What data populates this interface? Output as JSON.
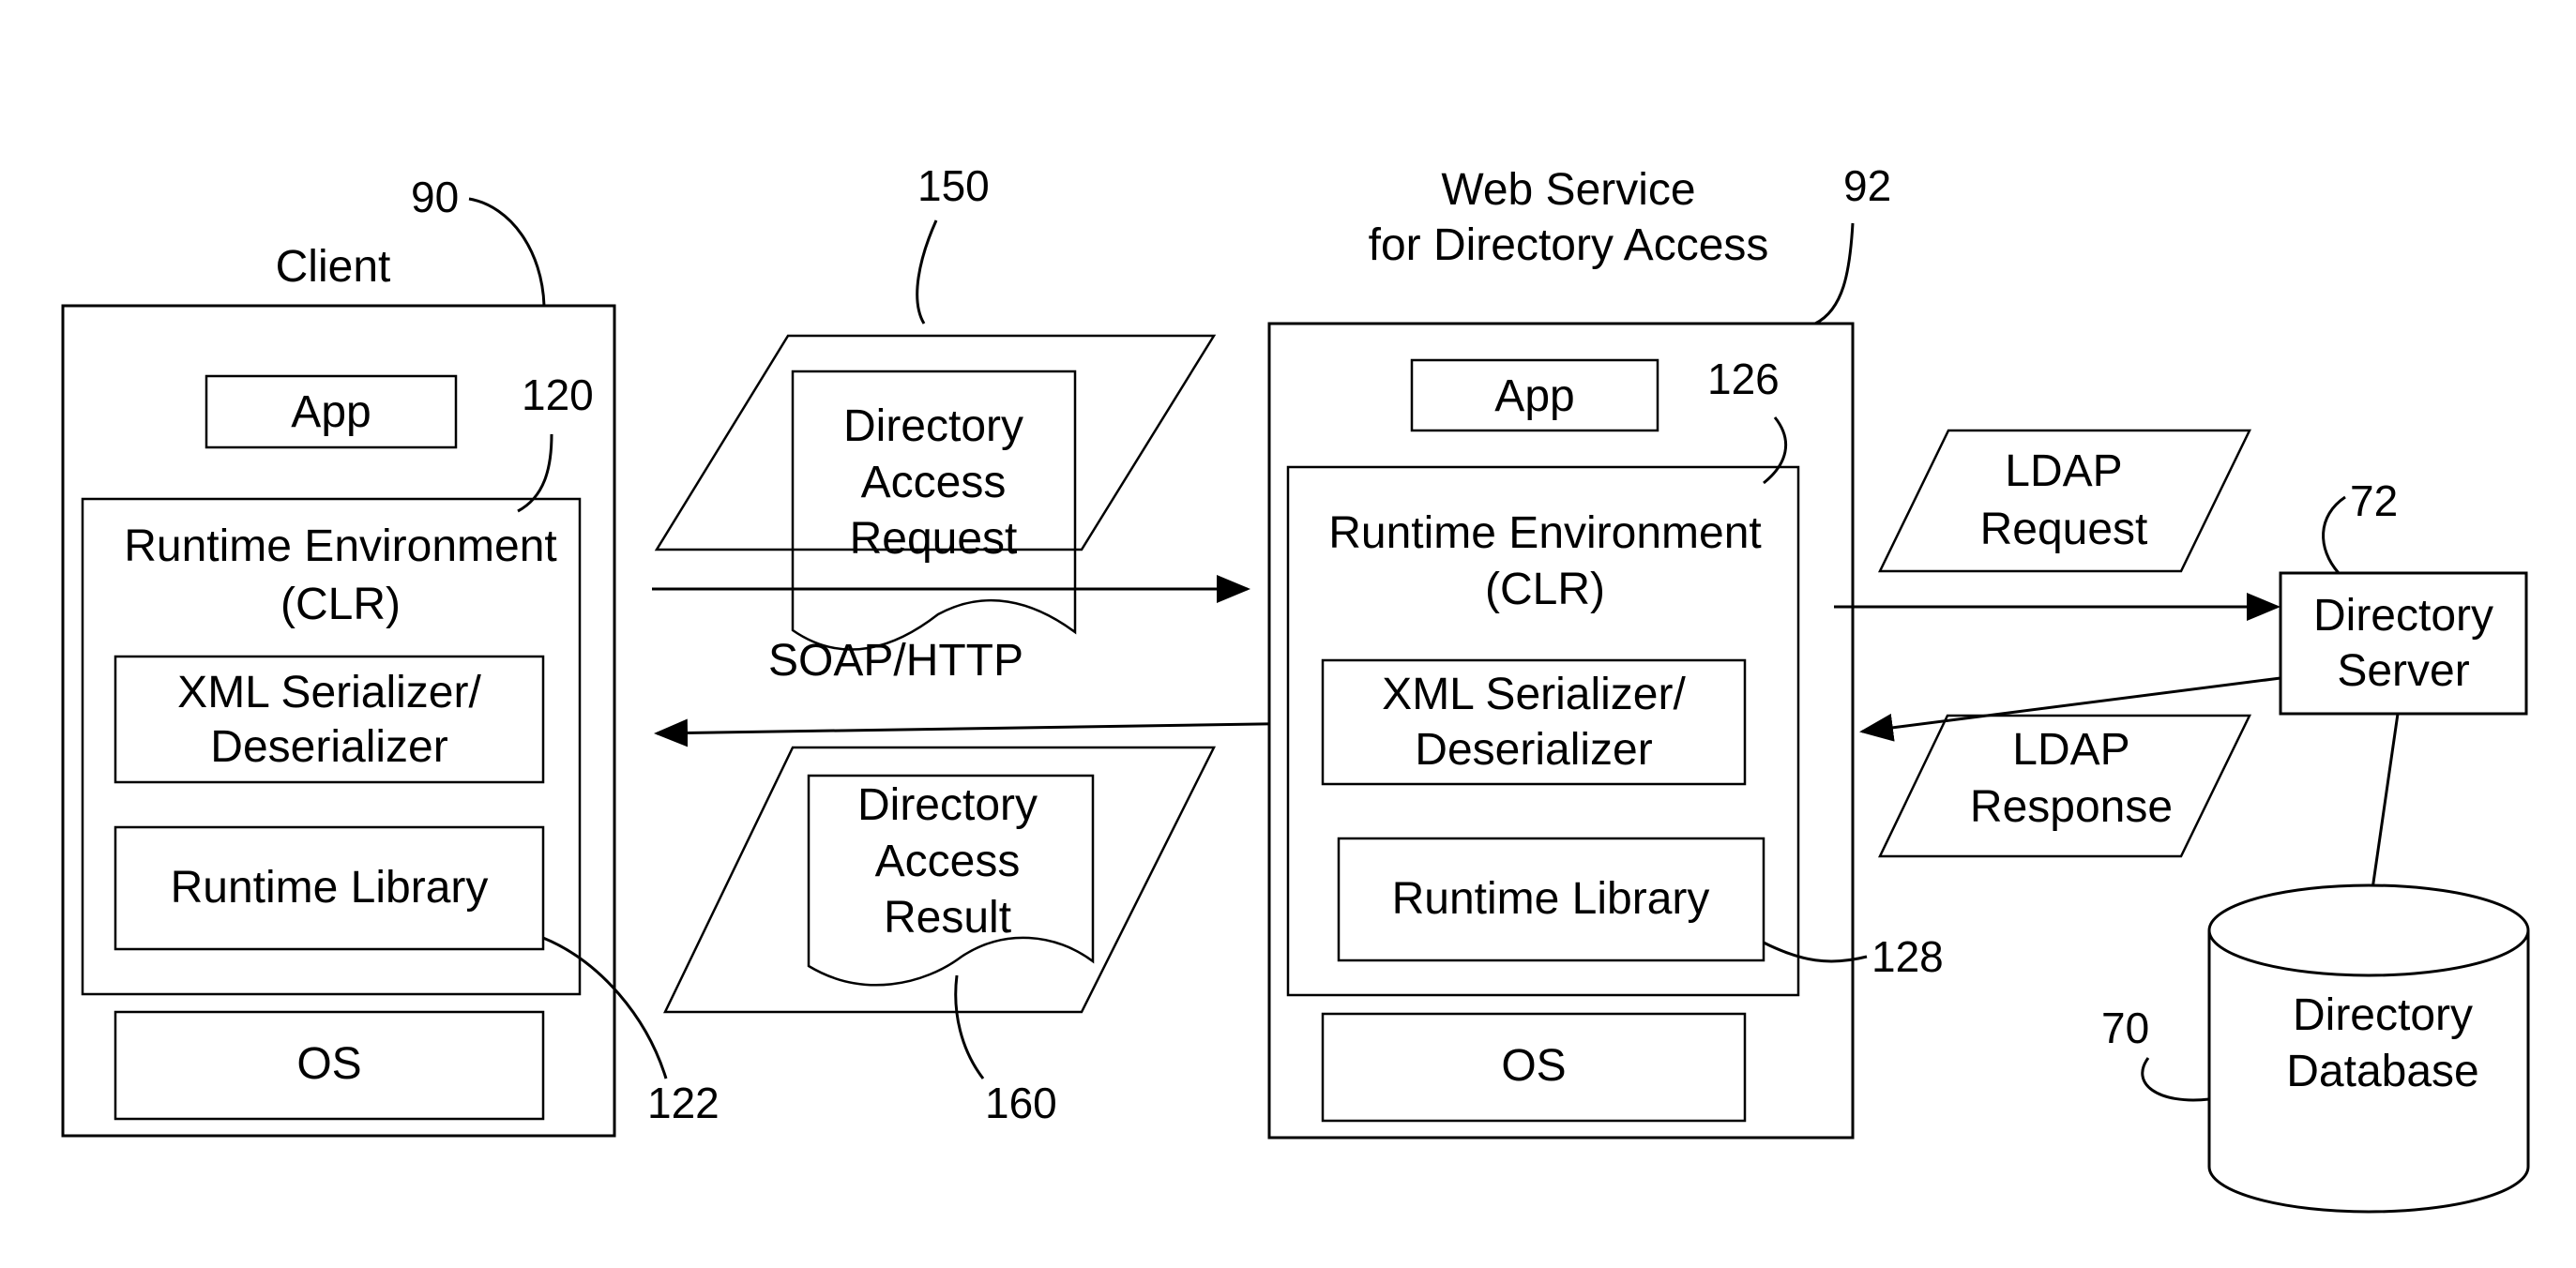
{
  "client": {
    "title": "Client",
    "ref": "90",
    "app": "App",
    "runtime_ref": "120",
    "runtime_line1": "Runtime Environment",
    "runtime_line2": "(CLR)",
    "xml_line1": "XML Serializer/",
    "xml_line2": "Deserializer",
    "library": "Runtime Library",
    "library_ref": "122",
    "os": "OS"
  },
  "request_doc": {
    "ref": "150",
    "line1": "Directory",
    "line2": "Access",
    "line3": "Request"
  },
  "protocol_label": "SOAP/HTTP",
  "result_doc": {
    "ref": "160",
    "line1": "Directory",
    "line2": "Access",
    "line3": "Result"
  },
  "web_service": {
    "title_line1": "Web Service",
    "title_line2": "for Directory Access",
    "ref": "92",
    "app": "App",
    "runtime_ref": "126",
    "runtime_line1": "Runtime Environment",
    "runtime_line2": "(CLR)",
    "xml_line1": "XML Serializer/",
    "xml_line2": "Deserializer",
    "library": "Runtime Library",
    "library_ref": "128",
    "os": "OS"
  },
  "ldap_request": {
    "line1": "LDAP",
    "line2": "Request"
  },
  "ldap_response": {
    "line1": "LDAP",
    "line2": "Response"
  },
  "directory_server": {
    "ref": "72",
    "line1": "Directory",
    "line2": "Server"
  },
  "directory_database": {
    "ref": "70",
    "line1": "Directory",
    "line2": "Database"
  }
}
